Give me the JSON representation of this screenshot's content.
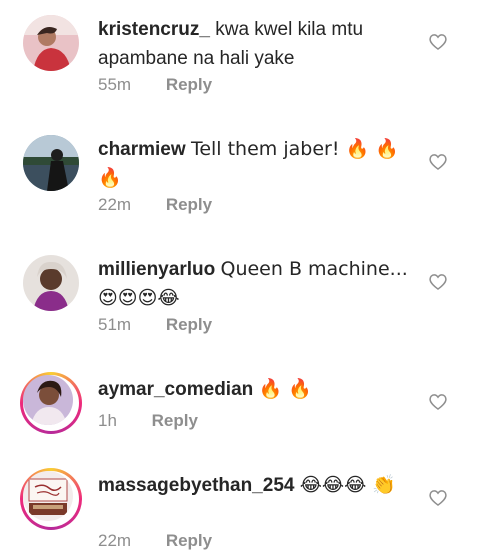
{
  "comments": [
    {
      "username": "kristencruz_",
      "text": "kwa kwel kila mtu apambane na hali yake",
      "time": "55m",
      "reply_label": "Reply",
      "has_story_ring": false
    },
    {
      "username": "charmiew",
      "text": "Tell them jaber! 🔥 🔥 🔥",
      "time": "22m",
      "reply_label": "Reply",
      "has_story_ring": false
    },
    {
      "username": "millienyarluo",
      "text": "Queen B machine... 😍😍😍😂",
      "time": "51m",
      "reply_label": "Reply",
      "has_story_ring": false
    },
    {
      "username": "aymar_comedian",
      "text": "🔥 🔥",
      "time": "1h",
      "reply_label": "Reply",
      "has_story_ring": true
    },
    {
      "username": "massagebyethan_254",
      "text": "😂😂😂 👏",
      "time": "22m",
      "reply_label": "Reply",
      "has_story_ring": true
    }
  ],
  "icons": {
    "like": "heart-outline-icon"
  },
  "colors": {
    "text": "#262626",
    "secondary": "#8e8e8e",
    "story_ring": "#ee2a7b"
  }
}
